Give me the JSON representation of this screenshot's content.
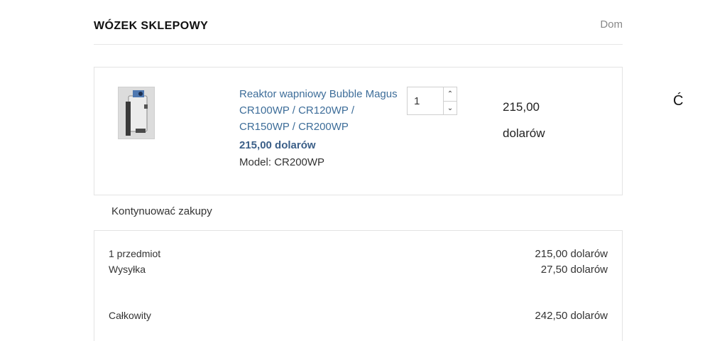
{
  "header": {
    "title": "WÓZEK SKLEPOWY",
    "breadcrumb_home": "Dom"
  },
  "cart": {
    "items": [
      {
        "image_icon": "product-thumbnail",
        "name": "Reaktor wapniowy Bubble Magus CR100WP / CR120WP / CR150WP / CR200WP",
        "unit_price": "215,00 dolarów",
        "model": "Model: CR200WP",
        "quantity": "1",
        "line_total": "215,00 dolarów",
        "remove_glyph": "Ć"
      }
    ],
    "continue_label": "Kontynuować zakupy"
  },
  "summary": {
    "items_label": "1 przedmiot",
    "items_value": "215,00 dolarów",
    "shipping_label": "Wysyłka",
    "shipping_value": "27,50 dolarów",
    "total_label": "Całkowity",
    "total_value": "242,50 dolarów"
  },
  "icons": {
    "qty_up": "chevron-up-icon",
    "qty_down": "chevron-down-icon"
  },
  "colors": {
    "link": "#3d6d99",
    "price": "#3b5f88",
    "border": "#e3e3e3"
  }
}
